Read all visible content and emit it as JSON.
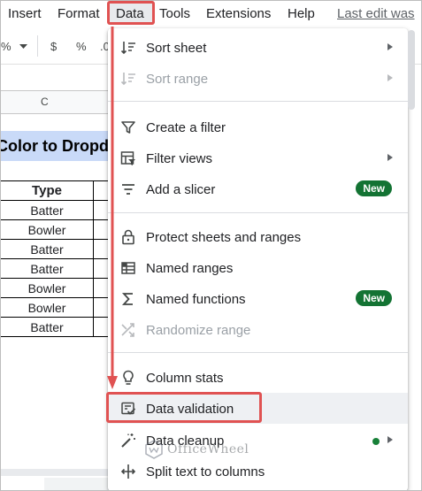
{
  "menubar": {
    "insert": "Insert",
    "format": "Format",
    "data": "Data",
    "tools": "Tools",
    "extensions": "Extensions",
    "help": "Help",
    "last_edit": "Last edit was"
  },
  "toolbar": {
    "percent": "%",
    "dollar": "$",
    "percent2": "%",
    "decimal": ".0"
  },
  "sheet": {
    "column_header": "C",
    "banner": "Color to Dropdown",
    "table_header": "Type",
    "rows": [
      "Batter",
      "Bowler",
      "Batter",
      "Batter",
      "Bowler",
      "Bowler",
      "Batter"
    ]
  },
  "menu": {
    "items": [
      {
        "label": "Sort sheet",
        "icon": "sort-icon"
      },
      {
        "label": "Sort range",
        "icon": "sort-range-icon"
      },
      {
        "label": "Create a filter",
        "icon": "filter-icon"
      },
      {
        "label": "Filter views",
        "icon": "filter-views-icon"
      },
      {
        "label": "Add a slicer",
        "icon": "slicer-icon",
        "badge": "New"
      },
      {
        "label": "Protect sheets and ranges",
        "icon": "lock-icon"
      },
      {
        "label": "Named ranges",
        "icon": "named-ranges-icon"
      },
      {
        "label": "Named functions",
        "icon": "sigma-icon",
        "badge": "New"
      },
      {
        "label": "Randomize range",
        "icon": "shuffle-icon"
      },
      {
        "label": "Column stats",
        "icon": "bulb-icon"
      },
      {
        "label": "Data validation",
        "icon": "data-validation-icon"
      },
      {
        "label": "Data cleanup",
        "icon": "wand-icon"
      },
      {
        "label": "Split text to columns",
        "icon": "split-icon"
      }
    ]
  },
  "watermark": {
    "text": "OfficeWheel"
  },
  "colors": {
    "highlight": "#e05252",
    "badge": "#137333",
    "banner": "#c9daf8"
  }
}
